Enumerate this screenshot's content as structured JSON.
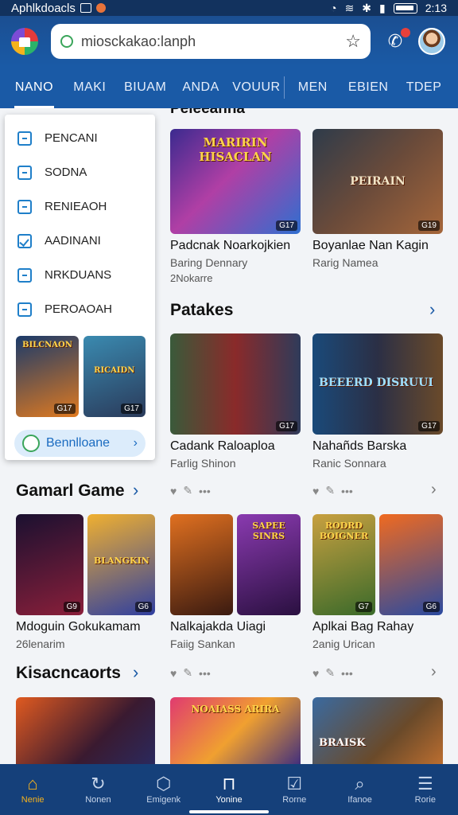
{
  "status_bar": {
    "app_name": "Aphlkdoacls",
    "time": "2:13"
  },
  "search": {
    "value": "miosckakao:lanph"
  },
  "tabs": [
    "NANO",
    "MAKI",
    "BIUAM",
    "ANDA",
    "VOUUR",
    "MEN",
    "EBIEN",
    "TDEP"
  ],
  "dropdown": {
    "items": [
      "PENCANI",
      "SODNA",
      "RENIEAOH",
      "AADINANI",
      "NRKDUANS",
      "PEROAOAH"
    ],
    "thumb_tags": [
      "G17",
      "G17"
    ],
    "thumb_art": [
      "BILCNAON",
      "RICAIDN"
    ],
    "button_label": "Bennlloane"
  },
  "sections": {
    "top_partial_title": "Peieeanna",
    "patakes_title": "Patakes",
    "gamar_title": "Gamarl Game",
    "kisac_title": "Kisacncaorts"
  },
  "cards": {
    "top": [
      {
        "title": "Padcnak Noarkojkien",
        "subtitle": "Baring Dennary",
        "extra": "2Nokarre",
        "tag": "G17",
        "art": "MARIRIN HISACLAN"
      },
      {
        "title": "Boyanlae Nan Kagin",
        "subtitle": "Rarig Namea",
        "tag": "G19",
        "art": "PEIRAIN"
      }
    ],
    "patakes": [
      {
        "title": "Cadank Raloaploa",
        "subtitle": "Farlig Shinon",
        "tag": "G17",
        "art": ""
      },
      {
        "title": "Nahañds Barska",
        "subtitle": "Ranic Sonnara",
        "tag": "G17",
        "art": "BEEERD DISRUUI"
      }
    ],
    "gamar": [
      {
        "title": "Mdoguin Gokukamam",
        "subtitle": "26lenarim",
        "tags": [
          "G9",
          "G6"
        ],
        "art": "BLANGKIN"
      },
      {
        "title": "Nalkajakda Uiagi",
        "subtitle": "Faiig Sankan",
        "tags": [
          "",
          ""
        ],
        "art": "SAPEE SINRS"
      },
      {
        "title": "Aplkai Bag Rahay",
        "subtitle": "2anig Urican",
        "tags": [
          "G7",
          "G6"
        ],
        "art": "RODRD BOIGNER"
      }
    ],
    "kisac": [
      {
        "art": ""
      },
      {
        "art": "NOAIASS ARIRA"
      },
      {
        "art": "BRAISK"
      }
    ]
  },
  "bottom_nav": [
    {
      "label": "Nenie",
      "icon": "home-icon"
    },
    {
      "label": "Nonen",
      "icon": "refresh-icon"
    },
    {
      "label": "Emigenk",
      "icon": "box-icon"
    },
    {
      "label": "Yonine",
      "icon": "shop-icon"
    },
    {
      "label": "Rorne",
      "icon": "chart-icon"
    },
    {
      "label": "Ifanoe",
      "icon": "search-icon"
    },
    {
      "label": "Rorie",
      "icon": "menu-icon"
    }
  ],
  "colors": {
    "primary": "#1a5aa6",
    "bottom_nav": "#15407a",
    "active_nav": "#f5b21d"
  }
}
